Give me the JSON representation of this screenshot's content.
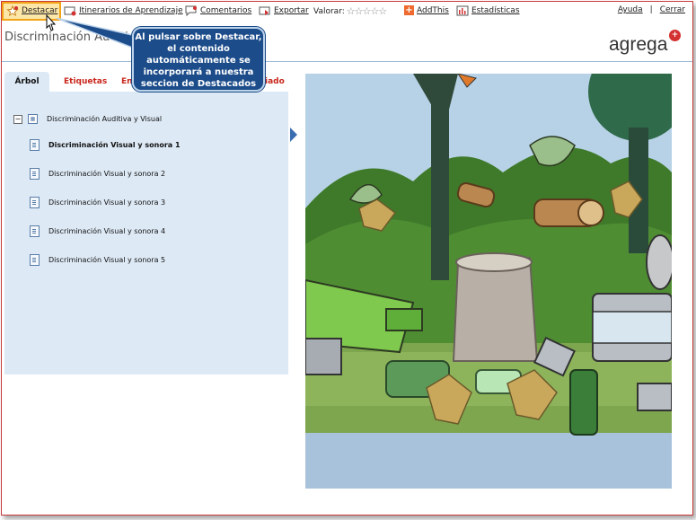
{
  "toolbar": {
    "destacar": "Destacar",
    "itinerarios": "Itinerarios de Aprendizaje",
    "comentarios": "Comentarios",
    "exportar": "Exportar",
    "valorar": "Valorar:",
    "stars": "☆☆☆☆☆",
    "addthis": "AddThis",
    "estadisticas": "Estadísticas",
    "ayuda": "Ayuda",
    "separator": "|",
    "cerrar": "Cerrar"
  },
  "page": {
    "title": "Discriminación Auditiva",
    "logo": "agrega"
  },
  "callout": {
    "text": "Al pulsar sobre Destacar, el contenido automáticamente se incorporará a nuestra seccion de Destacados"
  },
  "tabs": [
    {
      "label": "Árbol"
    },
    {
      "label": "Etiquetas"
    },
    {
      "label": "En"
    },
    {
      "label": "iado"
    }
  ],
  "tree": {
    "root": {
      "label": "Discriminación Auditiva y Visual",
      "toggle": "−"
    },
    "items": [
      {
        "label": "Discriminación Visual y sonora 1",
        "selected": true
      },
      {
        "label": "Discriminación Visual y sonora 2",
        "selected": false
      },
      {
        "label": "Discriminación Visual y sonora 3",
        "selected": false
      },
      {
        "label": "Discriminación Visual y sonora 4",
        "selected": false
      },
      {
        "label": "Discriminación Visual y sonora 5",
        "selected": false
      }
    ]
  },
  "colors": {
    "accent_red": "#c8261b",
    "panel_blue": "#dde9f5",
    "callout_blue": "#1c4c8a",
    "highlight_orange": "#f2a316"
  }
}
